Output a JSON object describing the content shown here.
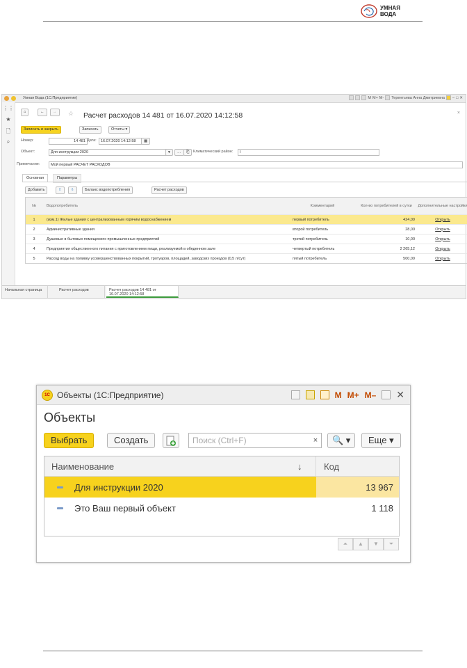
{
  "header": {
    "brand_line1": "УМНАЯ",
    "brand_line2": "ВОДА"
  },
  "shot1": {
    "window_title": "Умная Вода (1С:Предприятие)",
    "titlebar_right": {
      "m": "M",
      "mplus": "M+",
      "mminus": "M-",
      "user": "Терентьева Анна Дмитриевна"
    },
    "doc_title": "Расчет расходов 14 481 от 16.07.2020 14:12:58",
    "toolbar": {
      "save_close": "Записать и закрыть",
      "save": "Записать",
      "reports": "Отчеты ▾"
    },
    "fields": {
      "number_label": "Номер:",
      "number_value": "14 481",
      "date_label": "Дата:",
      "date_value": "16.07.2020 14:12:58",
      "object_label": "Объект:",
      "object_value": "Для инструкции 2020",
      "climate_label": "Климатический район:",
      "climate_value": "I",
      "note_label": "Примечание:",
      "note_value": "Мой первый РАСЧЕТ РАСХОДОВ"
    },
    "tabs": [
      "Основная",
      "Параметры"
    ],
    "table_toolbar": {
      "add": "Добавить",
      "balance": "Баланс водопотребления",
      "calc": "Расчет расходов"
    },
    "table": {
      "headers": [
        "№",
        "Водопотребитель",
        "Комментарий",
        "Кол-во потребителей в сутки",
        "Дополнительные настройки"
      ],
      "rows": [
        [
          "1",
          "(изм.1) Жилые здания с централизованным горячим водоснабжением",
          "первый потребитель",
          "424,00",
          "Открыть"
        ],
        [
          "2",
          "Административные здания",
          "второй потребитель",
          "28,00",
          "Открыть"
        ],
        [
          "3",
          "Душевые в бытовых помещениях промышленных предприятий",
          "третий потребитель",
          "10,00",
          "Открыть"
        ],
        [
          "4",
          "Предприятия общественного питания с приготовлением пищи, реализуемой в обеденном зале",
          "четвертый потребитель",
          "2 265,12",
          "Открыть"
        ],
        [
          "5",
          "Расход воды на поливку усовершенствованных покрытий, тротуаров, площадей, заводских проездов (0,5 л/сут)",
          "пятый потребитель",
          "500,00",
          "Открыть"
        ]
      ]
    },
    "bottom_tabs": [
      "Начальная страница",
      "Расчет расходов",
      "Расчет расходов 14 481 от 16.07.2020 14:12:58"
    ]
  },
  "shot2": {
    "logo_text": "1С",
    "window_title": "Объекты (1С:Предприятие)",
    "titlebar_right": {
      "m": "M",
      "mplus": "M+",
      "mminus": "M–",
      "close": "✕"
    },
    "heading": "Объекты",
    "buttons": {
      "select": "Выбрать",
      "create": "Создать",
      "more": "Еще ▾",
      "search_btn": "🔍 ▾"
    },
    "search_placeholder": "Поиск (Ctrl+F)",
    "search_clear": "×",
    "table": {
      "col_name": "Наименование",
      "col_sort": "↓",
      "col_code": "Код",
      "rows": [
        {
          "name": "Для инструкции 2020",
          "code": "13 967"
        },
        {
          "name": "Это Ваш первый объект",
          "code": "1 118"
        }
      ]
    }
  }
}
